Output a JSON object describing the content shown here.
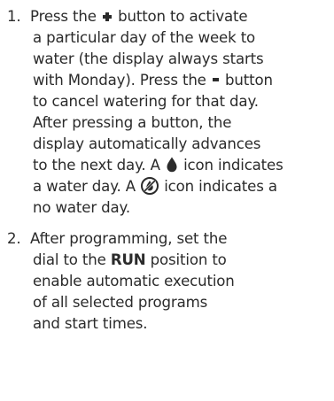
{
  "instructions": {
    "step1": {
      "number": "1.",
      "line1_a": "Press the ",
      "plus_icon": "plus-icon",
      "line1_b": " button to activate",
      "line2": "a particular day of the week to",
      "line3": "water (the display always starts",
      "line4_a": "with Monday). Press the ",
      "minus_icon": "minus-icon",
      "line4_b": " button",
      "line5": "to cancel watering for that day.",
      "line6": "After pressing a button, the",
      "line7": "display automatically advances",
      "line8_a": "to the next day. A ",
      "water_icon": "water-drop-icon",
      "line8_b": " icon indicates",
      "line9_a": "a water day. A ",
      "no_water_icon": "no-water-icon",
      "line9_b": " icon indicates a",
      "line10": "no water day."
    },
    "step2": {
      "number": "2.",
      "line1": "After programming, set the",
      "line2_a": "dial to the ",
      "line2_bold": "RUN",
      "line2_b": " position to",
      "line3": "enable automatic execution",
      "line4": "of all selected programs",
      "line5": "and start times."
    }
  }
}
